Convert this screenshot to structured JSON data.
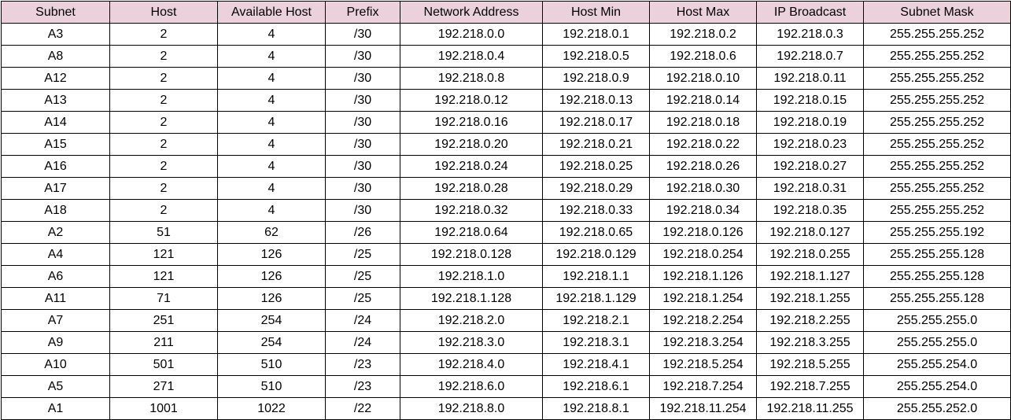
{
  "table": {
    "headers": [
      "Subnet",
      "Host",
      "Available Host",
      "Prefix",
      "Network Address",
      "Host Min",
      "Host Max",
      "IP Broadcast",
      "Subnet Mask"
    ],
    "rows": [
      [
        "A3",
        "2",
        "4",
        "/30",
        "192.218.0.0",
        "192.218.0.1",
        "192.218.0.2",
        "192.218.0.3",
        "255.255.255.252"
      ],
      [
        "A8",
        "2",
        "4",
        "/30",
        "192.218.0.4",
        "192.218.0.5",
        "192.218.0.6",
        "192.218.0.7",
        "255.255.255.252"
      ],
      [
        "A12",
        "2",
        "4",
        "/30",
        "192.218.0.8",
        "192.218.0.9",
        "192.218.0.10",
        "192.218.0.11",
        "255.255.255.252"
      ],
      [
        "A13",
        "2",
        "4",
        "/30",
        "192.218.0.12",
        "192.218.0.13",
        "192.218.0.14",
        "192.218.0.15",
        "255.255.255.252"
      ],
      [
        "A14",
        "2",
        "4",
        "/30",
        "192.218.0.16",
        "192.218.0.17",
        "192.218.0.18",
        "192.218.0.19",
        "255.255.255.252"
      ],
      [
        "A15",
        "2",
        "4",
        "/30",
        "192.218.0.20",
        "192.218.0.21",
        "192.218.0.22",
        "192.218.0.23",
        "255.255.255.252"
      ],
      [
        "A16",
        "2",
        "4",
        "/30",
        "192.218.0.24",
        "192.218.0.25",
        "192.218.0.26",
        "192.218.0.27",
        "255.255.255.252"
      ],
      [
        "A17",
        "2",
        "4",
        "/30",
        "192.218.0.28",
        "192.218.0.29",
        "192.218.0.30",
        "192.218.0.31",
        "255.255.255.252"
      ],
      [
        "A18",
        "2",
        "4",
        "/30",
        "192.218.0.32",
        "192.218.0.33",
        "192.218.0.34",
        "192.218.0.35",
        "255.255.255.252"
      ],
      [
        "A2",
        "51",
        "62",
        "/26",
        "192.218.0.64",
        "192.218.0.65",
        "192.218.0.126",
        "192.218.0.127",
        "255.255.255.192"
      ],
      [
        "A4",
        "121",
        "126",
        "/25",
        "192.218.0.128",
        "192.218.0.129",
        "192.218.0.254",
        "192.218.0.255",
        "255.255.255.128"
      ],
      [
        "A6",
        "121",
        "126",
        "/25",
        "192.218.1.0",
        "192.218.1.1",
        "192.218.1.126",
        "192.218.1.127",
        "255.255.255.128"
      ],
      [
        "A11",
        "71",
        "126",
        "/25",
        "192.218.1.128",
        "192.218.1.129",
        "192.218.1.254",
        "192.218.1.255",
        "255.255.255.128"
      ],
      [
        "A7",
        "251",
        "254",
        "/24",
        "192.218.2.0",
        "192.218.2.1",
        "192.218.2.254",
        "192.218.2.255",
        "255.255.255.0"
      ],
      [
        "A9",
        "211",
        "254",
        "/24",
        "192.218.3.0",
        "192.218.3.1",
        "192.218.3.254",
        "192.218.3.255",
        "255.255.255.0"
      ],
      [
        "A10",
        "501",
        "510",
        "/23",
        "192.218.4.0",
        "192.218.4.1",
        "192.218.5.254",
        "192.218.5.255",
        "255.255.254.0"
      ],
      [
        "A5",
        "271",
        "510",
        "/23",
        "192.218.6.0",
        "192.218.6.1",
        "192.218.7.254",
        "192.218.7.255",
        "255.255.254.0"
      ],
      [
        "A1",
        "1001",
        "1022",
        "/22",
        "192.218.8.0",
        "192.218.8.1",
        "192.218.11.254",
        "192.218.11.255",
        "255.255.252.0"
      ]
    ]
  },
  "colors": {
    "header_background": "#ead1dc",
    "cell_background": "#ffffff",
    "border": "#000000",
    "text": "#000000"
  }
}
